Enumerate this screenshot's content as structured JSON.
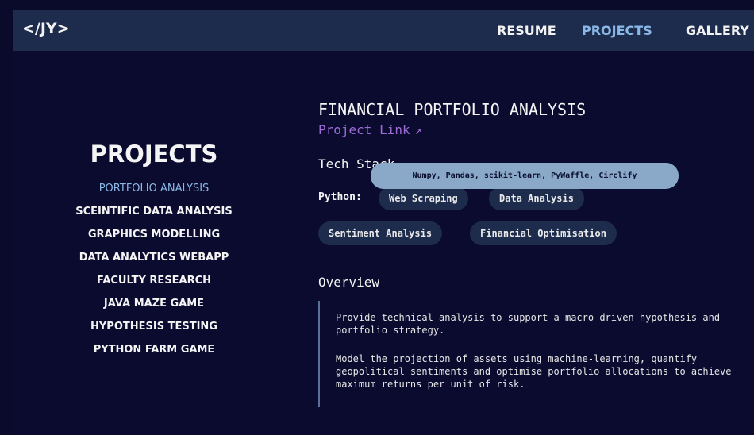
{
  "header": {
    "logo": "</JY>",
    "nav": [
      "RESUME",
      "PROJECTS",
      "GALLERY"
    ]
  },
  "sidebar": {
    "title": "PROJECTS",
    "items": [
      "PORTFOLIO ANALYSIS",
      "SCEINTIFIC DATA ANALYSIS",
      "GRAPHICS MODELLING",
      "DATA ANALYTICS WEBAPP",
      "FACULTY RESEARCH",
      "JAVA MAZE GAME",
      "HYPOTHESIS TESTING",
      "PYTHON FARM GAME"
    ],
    "active_index": 0
  },
  "project": {
    "title": "FINANCIAL PORTFOLIO ANALYSIS",
    "link_label": "Project Link",
    "link_icon": "external-link-icon"
  },
  "tech": {
    "title": "Tech Stack",
    "tooltip": "Numpy, Pandas, scikit-learn, PyWaffle, Circlify",
    "python_label": "Python:",
    "chips": [
      "Web Scraping",
      "Data Analysis",
      "Sentiment Analysis",
      "Financial Optimisation"
    ]
  },
  "overview": {
    "title": "Overview",
    "p1": "Provide technical analysis to support a macro-driven hypothesis and portfolio strategy.",
    "p2": "Model the projection of assets using machine-learning, quantify geopolitical sentiments and optimise portfolio allocations to achieve maximum returns per unit of risk."
  },
  "colors": {
    "background": "#0b0b30",
    "topbar": "#1d2b4c",
    "accent": "#8ab8e6",
    "link": "#9b6cd6",
    "chip": "#1d2b4c",
    "tooltip": "#8aa8c8"
  }
}
